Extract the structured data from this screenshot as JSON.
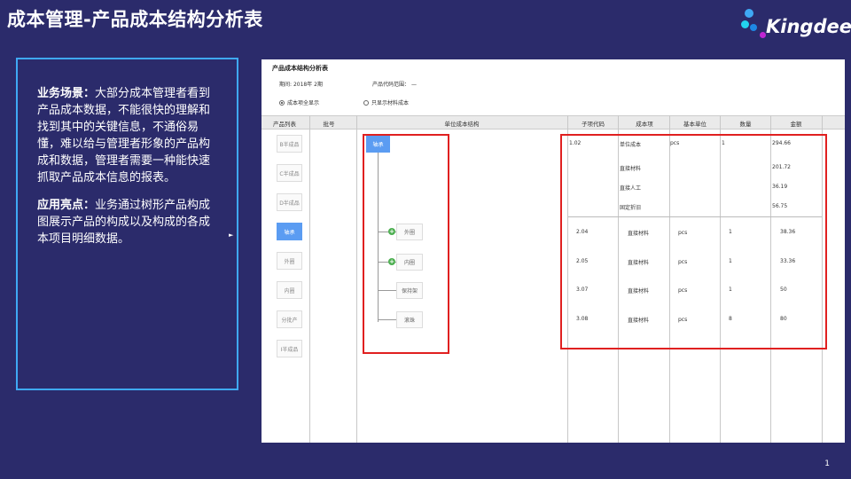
{
  "slide": {
    "title": "成本管理-产品成本结构分析表",
    "brand": "Kingdee",
    "page_number": "1"
  },
  "description": {
    "scenario_heading": "业务场景：",
    "scenario_text": "大部分成本管理者看到产品成本数据，不能很快的理解和找到其中的关键信息，不通俗易懂，难以给与管理者形象的产品构成和数据，管理者需要一种能快速抓取产品成本信息的报表。",
    "highlight_heading": "应用亮点：",
    "highlight_text": "业务通过树形产品构成图展示产品的构成以及构成的各成本项目明细数据。",
    "arrow": "►"
  },
  "report": {
    "title": "产品成本结构分析表",
    "period_label": "期间:",
    "period_value": "2018年  2期",
    "code_range_label": "产品代码范围：",
    "code_range_value": "—",
    "radio_all": "成本项全显示",
    "radio_material": "只显示材料成本",
    "columns": [
      "产品列表",
      "批号",
      "单位成本结构",
      "子项代码",
      "成本项",
      "基本单位",
      "数量",
      "金额"
    ],
    "product_list": [
      "B半成品",
      "C半成品",
      "D半成品",
      "轴承",
      "外圈",
      "内圈",
      "分批产",
      "I半成品"
    ],
    "tree": {
      "root": "轴承",
      "children": [
        "外圈",
        "内圈",
        "保持架",
        "滚珠"
      ]
    },
    "unit_cost_block": {
      "code": "1.02",
      "item_total": "单位成本",
      "unit": "pcs",
      "qty": "1",
      "amount_total": "294.66",
      "items": [
        {
          "name": "直接材料",
          "amount": "201.72"
        },
        {
          "name": "直接人工",
          "amount": "36.19"
        },
        {
          "name": "固定折旧",
          "amount": "56.75"
        }
      ]
    },
    "rows": [
      {
        "code": "2.04",
        "item": "直接材料",
        "unit": "pcs",
        "qty": "1",
        "amount": "38.36"
      },
      {
        "code": "2.05",
        "item": "直接材料",
        "unit": "pcs",
        "qty": "1",
        "amount": "33.36"
      },
      {
        "code": "3.07",
        "item": "直接材料",
        "unit": "pcs",
        "qty": "1",
        "amount": "50"
      },
      {
        "code": "3.08",
        "item": "直接材料",
        "unit": "pcs",
        "qty": "8",
        "amount": "80"
      }
    ]
  }
}
